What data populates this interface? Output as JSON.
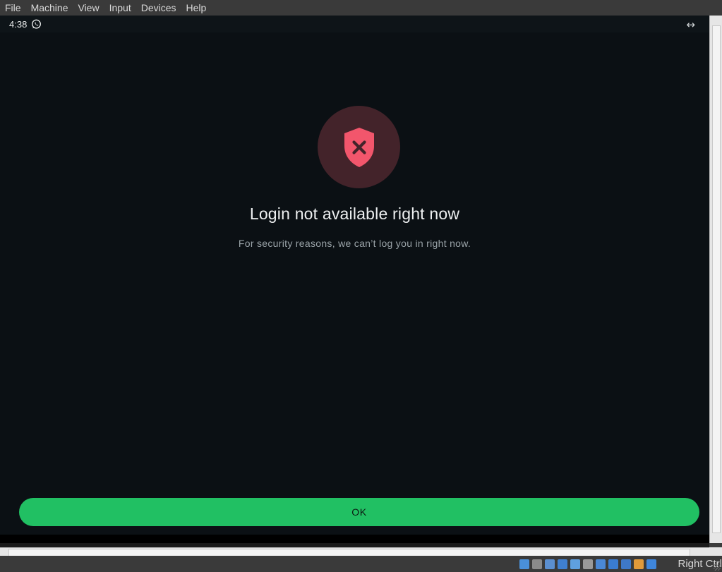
{
  "host": {
    "menu": [
      "File",
      "Machine",
      "View",
      "Input",
      "Devices",
      "Help"
    ],
    "host_key_label": "Right Ctrl",
    "tray_icons": [
      {
        "name": "hard-disk-icon",
        "color": "#4a90d9"
      },
      {
        "name": "optical-drive-icon",
        "color": "#8a8a8a"
      },
      {
        "name": "audio-icon",
        "color": "#5b8fd0"
      },
      {
        "name": "network-icon",
        "color": "#3f7fcf"
      },
      {
        "name": "usb-icon",
        "color": "#5fa0e0"
      },
      {
        "name": "shared-folders-icon",
        "color": "#9a9a9a"
      },
      {
        "name": "display-icon",
        "color": "#4a88d6"
      },
      {
        "name": "video-capture-icon",
        "color": "#3a7cd0"
      },
      {
        "name": "virtualization-icon",
        "color": "#3e78c8"
      },
      {
        "name": "mouse-integration-icon",
        "color": "#e09a3a"
      },
      {
        "name": "keyboard-capture-icon",
        "color": "#3f86db"
      }
    ]
  },
  "guest": {
    "status_bar": {
      "time": "4:38",
      "notification_icon": "whatsapp-icon",
      "resize_icon": "↔"
    },
    "dialog": {
      "icon": "shield-x-icon",
      "title": "Login not available right now",
      "message": "For security reasons, we can’t log you in right now.",
      "ok_label": "OK"
    }
  },
  "colors": {
    "background": "#0b1014",
    "accent": "#21c063",
    "shield": "#f2566c",
    "shield_circle": "#43232a"
  }
}
